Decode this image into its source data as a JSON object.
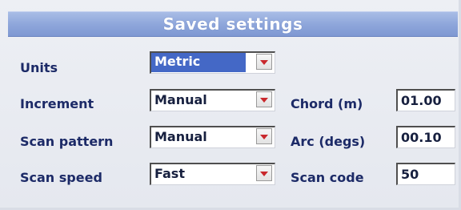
{
  "dialog": {
    "title": "Saved settings"
  },
  "fields": {
    "units": {
      "label": "Units",
      "value": "Metric",
      "selected": true
    },
    "increment": {
      "label": "Increment",
      "value": "Manual"
    },
    "scan_pattern": {
      "label": "Scan pattern",
      "value": "Manual"
    },
    "scan_speed": {
      "label": "Scan speed",
      "value": "Fast"
    },
    "chord": {
      "label": "Chord (m)",
      "value": "01.00"
    },
    "arc": {
      "label": "Arc (degs)",
      "value": "00.10"
    },
    "scan_code": {
      "label": "Scan code",
      "value": "50"
    }
  },
  "icons": {
    "dropdown": "chevron-down-icon"
  },
  "colors": {
    "title_bar": "#8fa7db",
    "label_text": "#1c2a67",
    "selection": "#4468c6",
    "dropdown_arrow": "#c9282c"
  }
}
